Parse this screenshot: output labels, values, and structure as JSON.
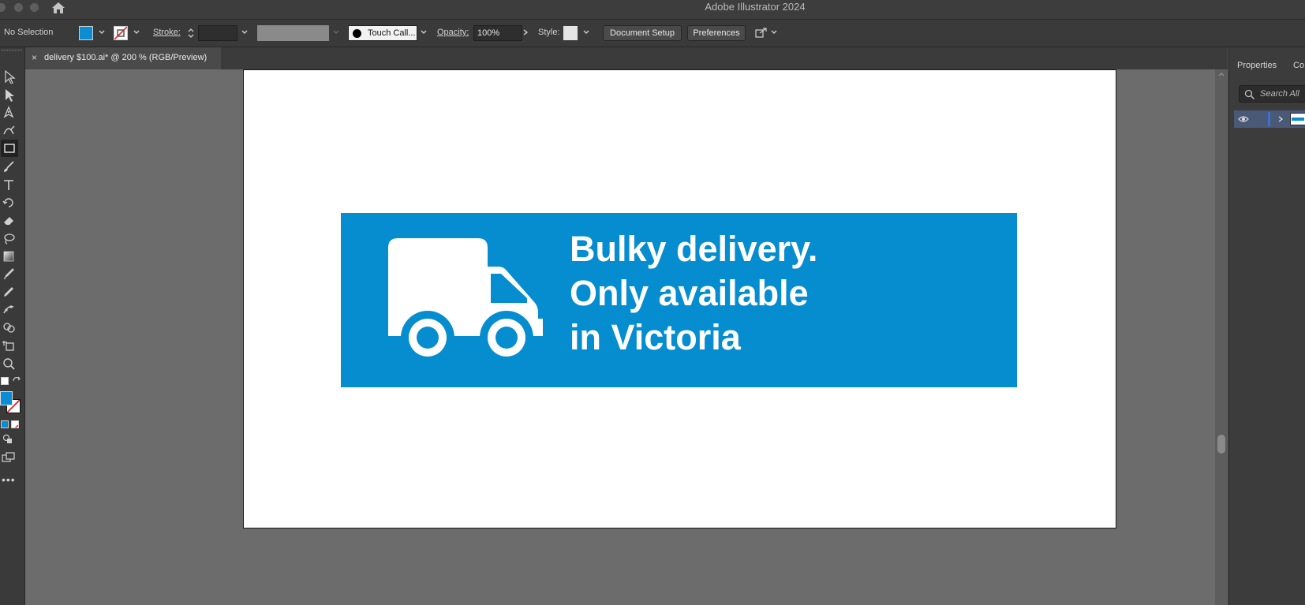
{
  "window": {
    "title": "Adobe Illustrator 2024"
  },
  "control_bar": {
    "selection_status": "No Selection",
    "fill_color": "#0a8dd3",
    "stroke_label": "Stroke:",
    "stroke_value": "",
    "brush_name": "Touch Call...",
    "opacity_label": "Opacity:",
    "opacity_value": "100%",
    "style_label": "Style:",
    "document_setup_label": "Document Setup",
    "preferences_label": "Preferences"
  },
  "document_tab": {
    "close_glyph": "×",
    "title": "delivery $100.ai* @ 200 % (RGB/Preview)"
  },
  "tools": [
    "selection-tool-icon",
    "direct-selection-tool-icon",
    "pen-tool-icon",
    "curvature-tool-icon",
    "rectangle-tool-icon",
    "paintbrush-tool-icon",
    "type-tool-icon",
    "rotate-tool-icon",
    "eraser-tool-icon",
    "lasso-tool-icon",
    "gradient-tool-icon",
    "eyedropper-tool-icon",
    "eyedropper-alt-tool-icon",
    "puppet-warp-tool-icon",
    "shape-builder-tool-icon",
    "artboard-tool-icon",
    "zoom-tool-icon"
  ],
  "artwork": {
    "banner_color": "#068dcf",
    "lines": [
      "Bulky delivery.",
      "Only available",
      "in Victoria"
    ]
  },
  "panel": {
    "tabs": [
      "Properties",
      "Co"
    ],
    "search_placeholder": "Search All"
  }
}
